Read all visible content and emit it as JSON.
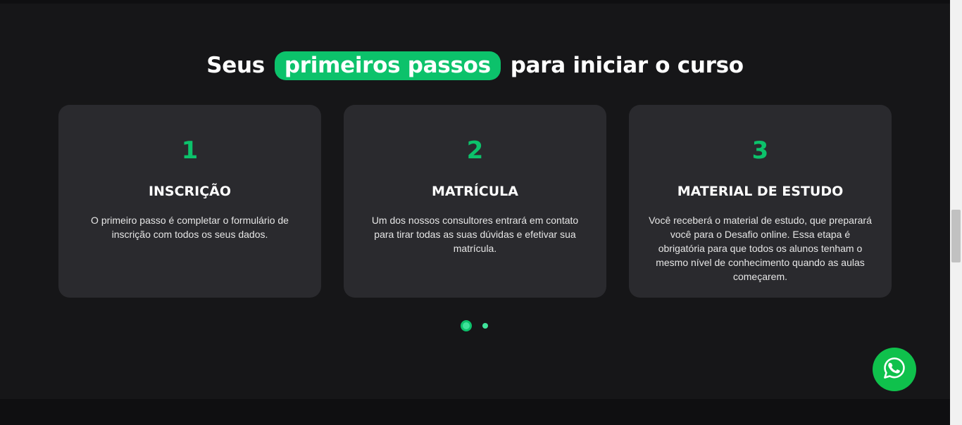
{
  "heading": {
    "before": "Seus",
    "highlight": "primeiros passos",
    "after": "para iniciar o curso"
  },
  "steps": [
    {
      "number": "1",
      "title": "INSCRIÇÃO",
      "description": "O primeiro passo é completar o formulário de inscrição com todos os seus dados."
    },
    {
      "number": "2",
      "title": "MATRÍCULA",
      "description": "Um dos nossos consultores entrará em contato para tirar todas as suas dúvidas e efetivar sua matrícula."
    },
    {
      "number": "3",
      "title": "MATERIAL DE ESTUDO",
      "description": "Você receberá o material de estudo, que preparará você para o Desafio online. Essa etapa é obrigatória para que todos os alunos tenham o mesmo nível de conhecimento quando as aulas começarem."
    }
  ],
  "carousel": {
    "pages": 2,
    "active_page": 1
  },
  "floating_button": {
    "icon": "whatsapp-icon"
  },
  "colors": {
    "accent": "#0cc26b",
    "background": "#161618",
    "card": "#2a2a2e",
    "whatsapp": "#0fc14c"
  }
}
